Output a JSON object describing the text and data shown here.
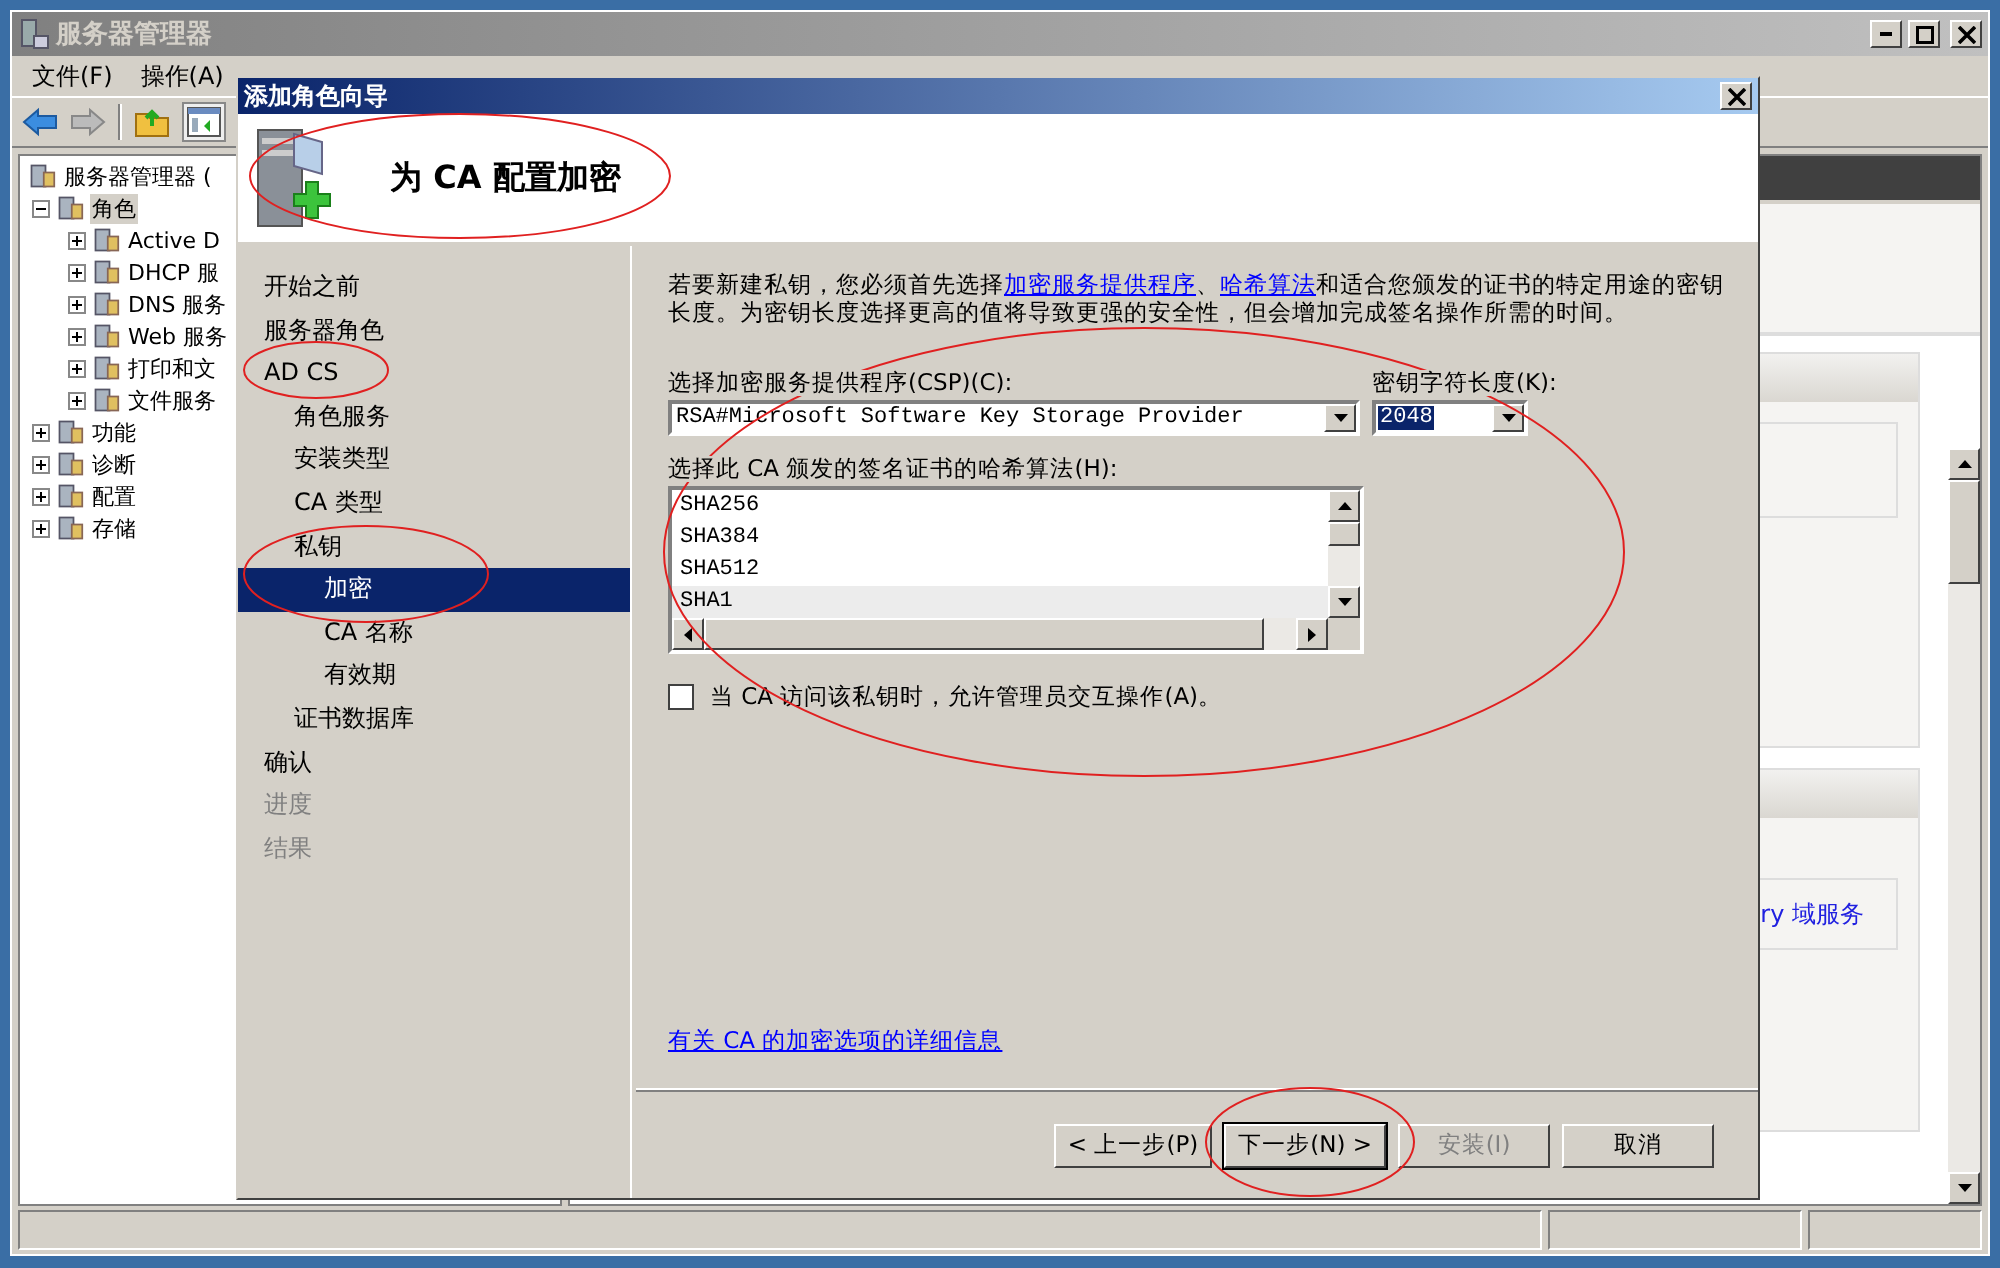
{
  "window": {
    "title": "服务器管理器"
  },
  "menu": [
    "文件(F)",
    "操作(A)"
  ],
  "tree": [
    {
      "label": "服务器管理器 (",
      "selected": false,
      "children": [
        {
          "label": "角色",
          "expanded": true,
          "selected": true,
          "children": [
            {
              "label": "Active D",
              "expanded": false,
              "selected": false
            },
            {
              "label": "DHCP 服",
              "expanded": false,
              "selected": false
            },
            {
              "label": "DNS 服务",
              "expanded": false,
              "selected": false
            },
            {
              "label": "Web 服务",
              "expanded": false,
              "selected": false
            },
            {
              "label": "打印和文",
              "expanded": false,
              "selected": false
            },
            {
              "label": "文件服务",
              "expanded": false,
              "selected": false
            }
          ]
        },
        {
          "label": "功能",
          "expanded": false,
          "selected": false
        },
        {
          "label": "诊断",
          "expanded": false,
          "selected": false
        },
        {
          "label": "配置",
          "expanded": false,
          "selected": false
        },
        {
          "label": "存储",
          "expanded": false,
          "selected": false
        }
      ]
    }
  ],
  "right_pane": {
    "link": "ry 域服务"
  },
  "dialog": {
    "title": "添加角色向导",
    "heading": "为 CA 配置加密",
    "steps": [
      {
        "label": "开始之前",
        "selected": false,
        "disabled": false
      },
      {
        "label": "服务器角色",
        "selected": false,
        "disabled": false
      },
      {
        "label": "AD CS",
        "selected": false,
        "disabled": false,
        "children": [
          {
            "label": "角色服务",
            "selected": false,
            "disabled": false
          },
          {
            "label": "安装类型",
            "selected": false,
            "disabled": false
          },
          {
            "label": "CA 类型",
            "selected": false,
            "disabled": false
          },
          {
            "label": "私钥",
            "selected": false,
            "disabled": false,
            "children": [
              {
                "label": "加密",
                "selected": true,
                "disabled": false
              },
              {
                "label": "CA 名称",
                "selected": false,
                "disabled": false
              },
              {
                "label": "有效期",
                "selected": false,
                "disabled": false
              }
            ]
          },
          {
            "label": "证书数据库",
            "selected": false,
            "disabled": false
          }
        ]
      },
      {
        "label": "确认",
        "selected": false,
        "disabled": false
      },
      {
        "label": "进度",
        "selected": false,
        "disabled": true
      },
      {
        "label": "结果",
        "selected": false,
        "disabled": true
      }
    ],
    "intro": [
      {
        "text": "若要新建私钥，您必须首先选择",
        "link": false
      },
      {
        "text": "加密服务提供程序",
        "link": true
      },
      {
        "text": "、",
        "link": false
      },
      {
        "text": "哈希算法",
        "link": true
      },
      {
        "text": "和适合您颁发的证书的特定用途的密钥长度。为密钥长度选择更高的值将导致更强的安全性，但会增加完成签名操作所需的时间。",
        "link": false
      }
    ],
    "csp": {
      "label": "选择加密服务提供程序(CSP)(C):",
      "value": "RSA#Microsoft Software Key Storage Provider"
    },
    "key_length": {
      "label": "密钥字符长度(K):",
      "value": "2048"
    },
    "hash": {
      "label": "选择此 CA 颁发的签名证书的哈希算法(H):",
      "items": [
        {
          "label": "SHA256",
          "selected": false
        },
        {
          "label": "SHA384",
          "selected": false
        },
        {
          "label": "SHA512",
          "selected": false
        },
        {
          "label": "SHA1",
          "selected": true
        }
      ]
    },
    "admin_interaction": {
      "label": "当 CA 访问该私钥时，允许管理员交互操作(A)。",
      "checked": false
    },
    "details_link": "有关 CA 的加密选项的详细信息",
    "buttons": [
      {
        "label": "< 上一步(P)",
        "disabled": false,
        "default": false
      },
      {
        "label": "下一步(N) >",
        "disabled": false,
        "default": true
      },
      {
        "label": "安装(I)",
        "disabled": true,
        "default": false
      },
      {
        "label": "取消",
        "disabled": false,
        "default": false
      }
    ]
  }
}
